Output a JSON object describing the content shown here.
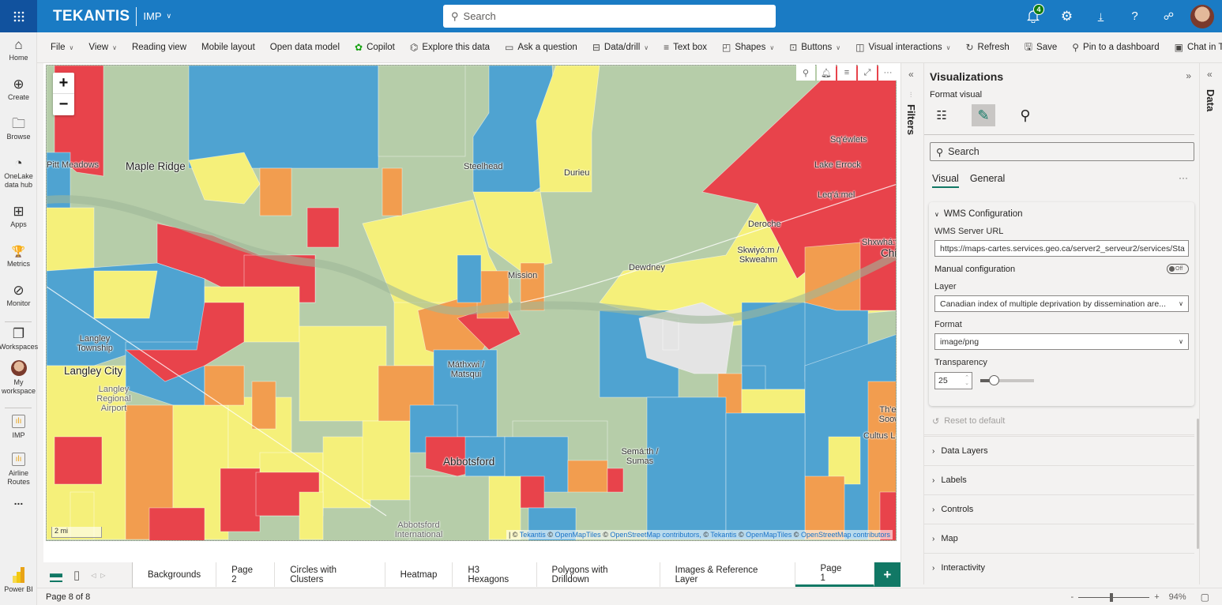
{
  "app": {
    "brand": "TEKANTIS",
    "workspace": "IMP",
    "search_placeholder": "Search",
    "notification_count": "4",
    "product": "Power BI"
  },
  "top_icons": [
    "bell-icon",
    "gear-icon",
    "download-icon",
    "help-icon",
    "feedback-icon"
  ],
  "leftnav": {
    "items": [
      {
        "label": "Home",
        "icon": "⌂"
      },
      {
        "label": "Create",
        "icon": "⊕"
      },
      {
        "label": "Browse",
        "icon": "🗀"
      },
      {
        "label": "OneLake data hub",
        "icon": "◔"
      },
      {
        "label": "Apps",
        "icon": "⊞"
      },
      {
        "label": "Metrics",
        "icon": "🏆"
      },
      {
        "label": "Monitor",
        "icon": "⊘"
      },
      {
        "label": "Workspaces",
        "icon": "❐"
      },
      {
        "label": "My workspace",
        "icon": ""
      },
      {
        "label": "IMP",
        "icon": "▮"
      },
      {
        "label": "Airline Routes",
        "icon": "▮"
      }
    ],
    "more": "..."
  },
  "ribbon": {
    "items": [
      {
        "label": "File",
        "icon": "",
        "dropdown": true
      },
      {
        "label": "View",
        "icon": "",
        "dropdown": true
      },
      {
        "label": "Reading view",
        "icon": "",
        "dropdown": false
      },
      {
        "label": "Mobile layout",
        "icon": "",
        "dropdown": false
      },
      {
        "label": "Open data model",
        "icon": "",
        "dropdown": false
      },
      {
        "label": "Copilot",
        "icon": "✿",
        "dropdown": false
      },
      {
        "label": "Explore this data",
        "icon": "⌬",
        "dropdown": false
      },
      {
        "label": "Ask a question",
        "icon": "▭",
        "dropdown": false
      },
      {
        "label": "Data/drill",
        "icon": "⊟",
        "dropdown": true
      },
      {
        "label": "Text box",
        "icon": "≡",
        "dropdown": false
      },
      {
        "label": "Shapes",
        "icon": "◰",
        "dropdown": true
      },
      {
        "label": "Buttons",
        "icon": "⊡",
        "dropdown": true
      },
      {
        "label": "Visual interactions",
        "icon": "◫",
        "dropdown": true
      },
      {
        "label": "Refresh",
        "icon": "↻",
        "dropdown": false
      },
      {
        "label": "Save",
        "icon": "🖫",
        "dropdown": false
      },
      {
        "label": "Pin to a dashboard",
        "icon": "⚲",
        "dropdown": false
      },
      {
        "label": "Chat in Teams",
        "icon": "▣",
        "dropdown": false
      }
    ]
  },
  "map": {
    "zoom_in": "+",
    "zoom_out": "−",
    "scale": "2 mi",
    "attribution": [
      "Tekantis",
      "OpenMapTiles",
      "OpenStreetMap contributors,",
      "Tekantis",
      "OpenMapTiles",
      "OpenStreetMap contributors"
    ],
    "colors": {
      "land": "#b6cda9",
      "red": "#e8434b",
      "orange": "#f29d4f",
      "yellow": "#f5f07a",
      "blue": "#4fa3d1",
      "gray": "#e4e4e4",
      "river": "#9fb79a"
    },
    "labels": [
      {
        "text": "Maple Ridge",
        "big": true
      },
      {
        "text": "Pitt Meadows",
        "big": false
      },
      {
        "text": "Steelhead",
        "big": false
      },
      {
        "text": "Durieu",
        "big": false
      },
      {
        "text": "Sq'éwlets",
        "big": false
      },
      {
        "text": "Lake Errock",
        "big": false
      },
      {
        "text": "Leq'á:mel",
        "big": false
      },
      {
        "text": "Deroche",
        "big": false
      },
      {
        "text": "Skwiyó:m / Skweahm",
        "big": false
      },
      {
        "text": "Shxwhá:y",
        "big": false
      },
      {
        "text": "Mission",
        "big": false
      },
      {
        "text": "Dewdney",
        "big": false
      },
      {
        "text": "Langley Township",
        "big": false
      },
      {
        "text": "Langley City",
        "big": true
      },
      {
        "text": "Langley Regional Airport",
        "big": false
      },
      {
        "text": "Máthxwi / Matsqui",
        "big": false
      },
      {
        "text": "Abbotsford",
        "big": true
      },
      {
        "text": "Semá:th / Sumas",
        "big": false
      },
      {
        "text": "Abbotsford International Airport",
        "big": false
      },
      {
        "text": "Th'ewá:li / Soowahlie",
        "big": false
      },
      {
        "text": "Cultus Lake",
        "big": false
      },
      {
        "text": "Chilliwack",
        "big": true
      }
    ]
  },
  "visual_header": [
    "pin-icon",
    "bell-icon",
    "filter-icon",
    "focus-mode-icon",
    "more-options-icon"
  ],
  "filters_pane": {
    "title": "Filters"
  },
  "data_pane": {
    "title": "Data"
  },
  "viz_pane": {
    "title": "Visualizations",
    "subtitle": "Format visual",
    "search_placeholder": "Search",
    "tabs": [
      {
        "label": "Visual",
        "active": true
      },
      {
        "label": "General",
        "active": false
      }
    ],
    "more": "···",
    "wms": {
      "title": "WMS Configuration",
      "server_url_label": "WMS Server URL",
      "server_url": "https://maps-cartes.services.geo.ca/server2_serveur2/services/Sta",
      "manual_label": "Manual configuration",
      "manual_state": "Off",
      "layer_label": "Layer",
      "layer_value": "Canadian index of multiple deprivation by dissemination are...",
      "format_label": "Format",
      "format_value": "image/png",
      "transparency_label": "Transparency",
      "transparency_value": "25",
      "transparency_percent": 25
    },
    "reset": "Reset to default",
    "sections": [
      "Data Layers",
      "Labels",
      "Controls",
      "Map",
      "Interactivity"
    ]
  },
  "pages": {
    "tabs": [
      {
        "label": "Backgrounds",
        "active": false
      },
      {
        "label": "Page 2",
        "active": false
      },
      {
        "label": "Circles with Clusters",
        "active": false
      },
      {
        "label": "Heatmap",
        "active": false
      },
      {
        "label": "H3 Hexagons",
        "active": false
      },
      {
        "label": "Polygons with Drilldown",
        "active": false
      },
      {
        "label": "Images & Reference Layer",
        "active": false
      },
      {
        "label": "Page 1",
        "active": true
      }
    ],
    "add": "+"
  },
  "status": {
    "page_info": "Page 8 of 8",
    "zoom_minus": "-",
    "zoom_plus": "+",
    "zoom": "94%"
  }
}
